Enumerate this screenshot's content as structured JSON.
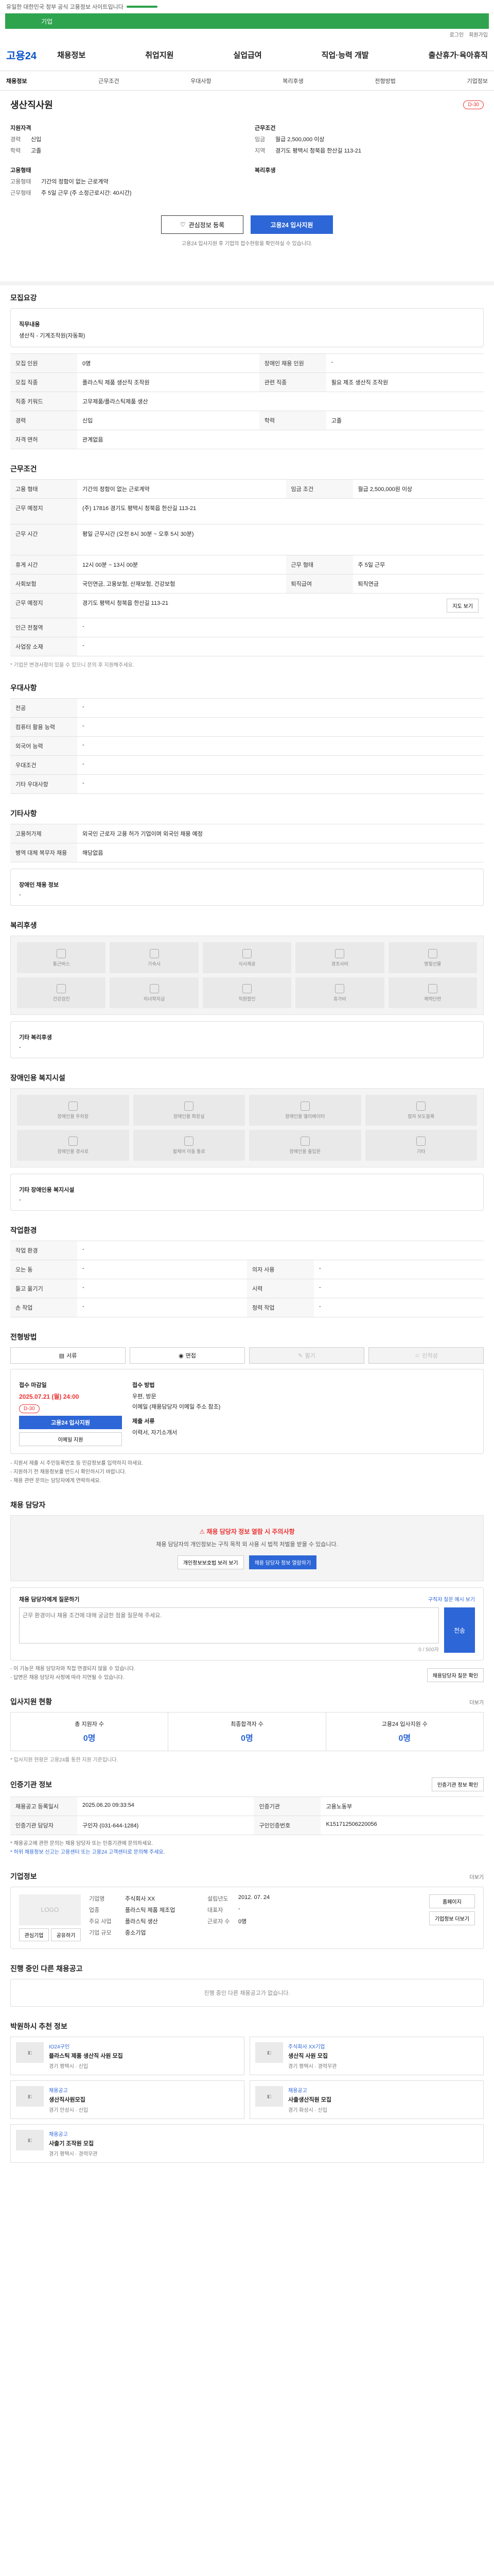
{
  "topbar": {
    "text": "유일한 대한민국 정부 공식 고용정보 사이트입니다"
  },
  "greenbar": {
    "text": "기업"
  },
  "util": {
    "links": [
      "로그인",
      "회원가입"
    ]
  },
  "header": {
    "logo": "고용24",
    "menu": [
      "채용정보",
      "취업지원",
      "실업급여",
      "직업·능력 개발",
      "출산휴가·육아휴직"
    ]
  },
  "subnav": {
    "items": [
      "채용정보",
      "근무조건",
      "우대사항",
      "복리후생",
      "전형방법",
      "기업정보"
    ]
  },
  "summary": {
    "company": "생산직사원",
    "badge": "D-30",
    "left_title": "지원자격",
    "left_rows": [
      {
        "k": "경력",
        "v": "신입"
      },
      {
        "k": "학력",
        "v": "고졸"
      }
    ],
    "left_title2": "고용형태",
    "left_rows2": [
      {
        "k": "고용형태",
        "v": "기간의 정함이 없는 근로계약"
      },
      {
        "k": "근무형태",
        "v": "주 5일 근무 (주 소정근로시간: 40시간)"
      }
    ],
    "right_title": "근무조건",
    "right_rows": [
      {
        "k": "임금",
        "v": "월급 2,500,000 이상"
      },
      {
        "k": "지역",
        "v": "경기도 평택시 청북읍 한산길 113-21"
      }
    ],
    "right_title2": "복리후생",
    "btn_scrap": "관심정보 등록",
    "btn_apply": "고용24 입사지원",
    "notice": "고용24 입사지원 후 기업의 접수현황을 확인하실 수 있습니다."
  },
  "qual": {
    "title": "모집요강",
    "job_title": "직무내용",
    "job_desc": "생산직 - 기계조작원(자동화)",
    "rows": [
      {
        "k": "모집 인원",
        "v": "0명",
        "k2": "장애인 채용 인원",
        "v2": "-"
      },
      {
        "k": "모집 직종",
        "v": "플라스틱 제품 생산직 조작원",
        "k2": "관련 직종",
        "v2": "필요 제조 생산직 조작원"
      },
      {
        "k": "직종 키워드",
        "v": "고무제품/플라스틱제품 생산",
        "k2": "",
        "v2": ""
      },
      {
        "k": "경력",
        "v": "신입",
        "k2": "학력",
        "v2": "고졸"
      },
      {
        "k": "자격 면허",
        "v": "관계없음",
        "k2": "",
        "v2": ""
      }
    ]
  },
  "cond": {
    "title": "근무조건",
    "rows": [
      {
        "k": "고용 형태",
        "v": "기간의 정함이 없는 근로계약",
        "k2": "임금 조건",
        "v2": "월급 2,500,000원 이상"
      },
      {
        "k": "근무 예정지",
        "v": "(주) 17816 경기도 평택시 청북읍 한산길 113-21",
        "k2": "",
        "v2": ""
      },
      {
        "k": "근무 시간",
        "v": "평일 근무시간 (오전 8시 30분 ~ 오후 5시 30분)",
        "k2": "",
        "v2": ""
      },
      {
        "k": "휴게 시간",
        "v": "12시 00분 ~ 13시 00분",
        "k2": "근무 형태",
        "v2": "주 5일 근무"
      },
      {
        "k": "사회보험",
        "v": "국민연금, 고용보험, 산재보험, 건강보험",
        "k2": "퇴직급여",
        "v2": "퇴직연금"
      },
      {
        "k": "근무 예정지",
        "v": "경기도 평택시 청북읍 한산길 113-21",
        "k2": "",
        "v2": ""
      },
      {
        "k": "인근 전철역",
        "v": "-",
        "k2": "",
        "v2": ""
      },
      {
        "k": "사업장 소재",
        "v": "-",
        "k2": "",
        "v2": ""
      }
    ],
    "map_btn": "지도 보기",
    "footnote": "* 기업은 변경사항이 있을 수 있으니 문의 후 지원해주세요."
  },
  "pref": {
    "title": "우대사항",
    "rows": [
      {
        "k": "전공",
        "v": "-"
      },
      {
        "k": "컴퓨터 활용 능력",
        "v": "-"
      },
      {
        "k": "외국어 능력",
        "v": "-"
      },
      {
        "k": "우대조건",
        "v": "-"
      },
      {
        "k": "기타 우대사항",
        "v": "-"
      }
    ]
  },
  "etc": {
    "title": "기타사항",
    "rows": [
      {
        "k": "고용허가제",
        "v": "외국인 근로자 고용 허가 기업이며 외국인 채용 예정"
      },
      {
        "k": "병역 대체 복무자 채용",
        "v": "해당없음"
      }
    ],
    "disabled_title": "장애인 채용 정보",
    "disabled_value": "-"
  },
  "welfare": {
    "title": "복리후생",
    "items": [
      "통근버스",
      "기숙사",
      "식사제공",
      "경조사비",
      "명절선물",
      "건강검진",
      "자녀학자금",
      "직원할인",
      "휴가비",
      "체력단련"
    ],
    "other_title": "기타 복리후생",
    "other_value": "-"
  },
  "facility": {
    "title": "장애인용 복지시설",
    "items": [
      "장애인용 주차장",
      "장애인용 화장실",
      "장애인용 엘리베이터",
      "점자 보도블록",
      "장애인용 경사로",
      "휠체어 이동 통로",
      "장애인용 출입문",
      "기타"
    ],
    "other_title": "기타 장애인용 복지시설",
    "other_value": "-"
  },
  "work_env": {
    "title": "작업환경",
    "rows": [
      {
        "k": "작업 환경",
        "v": "-",
        "k2": "",
        "v2": ""
      },
      {
        "k": "오는 동",
        "v": "-",
        "k2": "의자 사용",
        "v2": "-"
      },
      {
        "k": "들고 옮기기",
        "v": "-",
        "k2": "시력",
        "v2": "-"
      },
      {
        "k": "손 작업",
        "v": "-",
        "k2": "청력 작업",
        "v2": "-"
      }
    ]
  },
  "select": {
    "title": "전형방법",
    "tabs": [
      "서류",
      "면접",
      "필기",
      "인적성"
    ],
    "recv_title": "접수 마감일",
    "recv_date": "2025.07.21 (월) 24:00",
    "dday": "D-30",
    "btn_apply": "고용24 입사지원",
    "btn_email": "이메일 지원",
    "method_title": "접수 방법",
    "method_rows": [
      "우편, 방문",
      "이메일 (채용담당자 이메일 주소 참조)"
    ],
    "docs_title": "제출 서류",
    "docs_value": "이력서, 자기소개서",
    "notes": [
      "- 지원서 제출 시 주민등록번호 등 민감정보를 입력하지 마세요.",
      "- 지원하기 전 채용정보를 반드시 확인하시기 바랍니다.",
      "- 채용 관련 문의는 담당자에게 연락하세요."
    ]
  },
  "contact": {
    "title": "채용 담당자",
    "warn": "채용 담당자 정보 열람 시 주의사항",
    "desc": "채용 담당자의 개인정보는 구직 목적 외 사용 시 법적 처벌을 받을 수 있습니다.",
    "btn_view": "개인정보보호법 보러 보기",
    "btn_agree": "채용 담당자 정보 열람하기",
    "ask_title": "채용 담당자에게 질문하기",
    "ask_hint": "구직자 질문 예시 보기",
    "ask_placeholder": "근무 환경이나 채용 조건에 대해 궁금한 점을 질문해 주세요.",
    "counter": "0 / 500자",
    "btn_send": "전송",
    "notes": [
      "- 이 기능은 채용 담당자와 직접 연결되지 않을 수 있습니다.",
      "- 답변은 채용 담당자 사정에 따라 지연될 수 있습니다."
    ],
    "btn_more": "채용담당자 질문 확인"
  },
  "status": {
    "title": "입사지원 현황",
    "more": "더보기",
    "items": [
      {
        "label": "총 지원자 수",
        "value": "0명"
      },
      {
        "label": "최종합격자 수",
        "value": "0명"
      },
      {
        "label": "고용24 입사지원 수",
        "value": "0명"
      }
    ],
    "footnote": "* 입사지원 현황은 고용24를 통한 지원 기준입니다."
  },
  "auth": {
    "title": "인증기관 정보",
    "btn": "인증기관 정보 확인",
    "rows": [
      {
        "k": "채용공고 등록일시",
        "v": "2025.06.20 09:33:54",
        "k2": "인증기관",
        "v2": "고용노동부"
      },
      {
        "k": "인증기관 담당자",
        "v": "구인자 (031-644-1284)",
        "k2": "구인인증번호",
        "v2": "K151712506220056"
      }
    ],
    "notes": [
      "* 채용공고에 관한 문의는 채용 담당자 또는 인증기관에 문의하세요.",
      "* 허위 채용정보 신고는 고용센터 또는 고용24 고객센터로 문의해 주세요."
    ]
  },
  "company": {
    "title": "기업정보",
    "more": "더보기",
    "logo_text": "LOGO",
    "rows": [
      {
        "k": "기업명",
        "v": "주식회사 XX",
        "k2": "설립년도",
        "v2": "2012. 07. 24"
      },
      {
        "k": "업종",
        "v": "플라스틱 제품 제조업",
        "k2": "대표자",
        "v2": "-"
      },
      {
        "k": "주요 사업",
        "v": "플라스틱 생산",
        "k2": "근로자 수",
        "v2": "0명"
      },
      {
        "k": "기업 규모",
        "v": "중소기업",
        "k2": "",
        "v2": ""
      }
    ],
    "btn_home": "홈페이지",
    "btn_info": "기업정보 더보기",
    "btn_like": "관심기업",
    "btn_share": "공유하기"
  },
  "other_jobs": {
    "title": "진행 중인 다른 채용공고",
    "empty": "진행 중인 다른 채용공고가 없습니다."
  },
  "recommend": {
    "title": "박원하시 추천 정보",
    "cards": [
      {
        "tag": "IO24구인",
        "title": "플라스틱 제품 생산직 사원 모집",
        "sub": "경기 평택시 · 신입"
      },
      {
        "tag": "주식회사 XX기업",
        "title": "생산직 사원 모집",
        "sub": "경기 평택시 · 경력무관"
      },
      {
        "tag": "채용공고",
        "title": "생산직사원모집",
        "sub": "경기 안성시 · 신입"
      },
      {
        "tag": "채용공고",
        "title": "사출생산직원 모집",
        "sub": "경기 화성시 · 신입"
      }
    ],
    "single": {
      "tag": "채용공고",
      "title": "사출기 조작원 모집",
      "sub": "경기 평택시 · 경력무관"
    }
  }
}
